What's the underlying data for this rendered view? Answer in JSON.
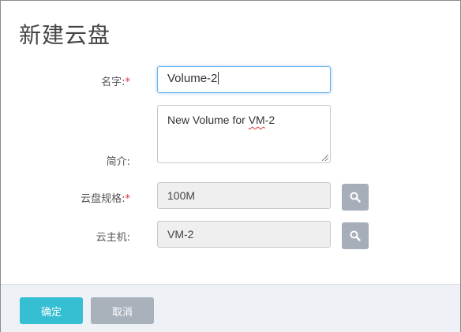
{
  "dialog": {
    "title": "新建云盘"
  },
  "form": {
    "name": {
      "label": "名字:",
      "required_mark": "*",
      "value": "Volume-2"
    },
    "description": {
      "label": "简介:",
      "value_before": "New Volume for ",
      "value_misspelled": "VM",
      "value_after": "-2"
    },
    "disk_spec": {
      "label": "云盘规格:",
      "required_mark": "*",
      "value": "100M"
    },
    "host": {
      "label": "云主机:",
      "value": "VM-2"
    }
  },
  "footer": {
    "confirm_label": "确定",
    "cancel_label": "取消"
  },
  "colors": {
    "primary": "#36bfd2",
    "secondary": "#a9b1bb",
    "required": "#e0303a",
    "icon_button": "#a6aeb9"
  },
  "icons": {
    "spec_lookup": "search-icon",
    "host_lookup": "search-icon"
  }
}
